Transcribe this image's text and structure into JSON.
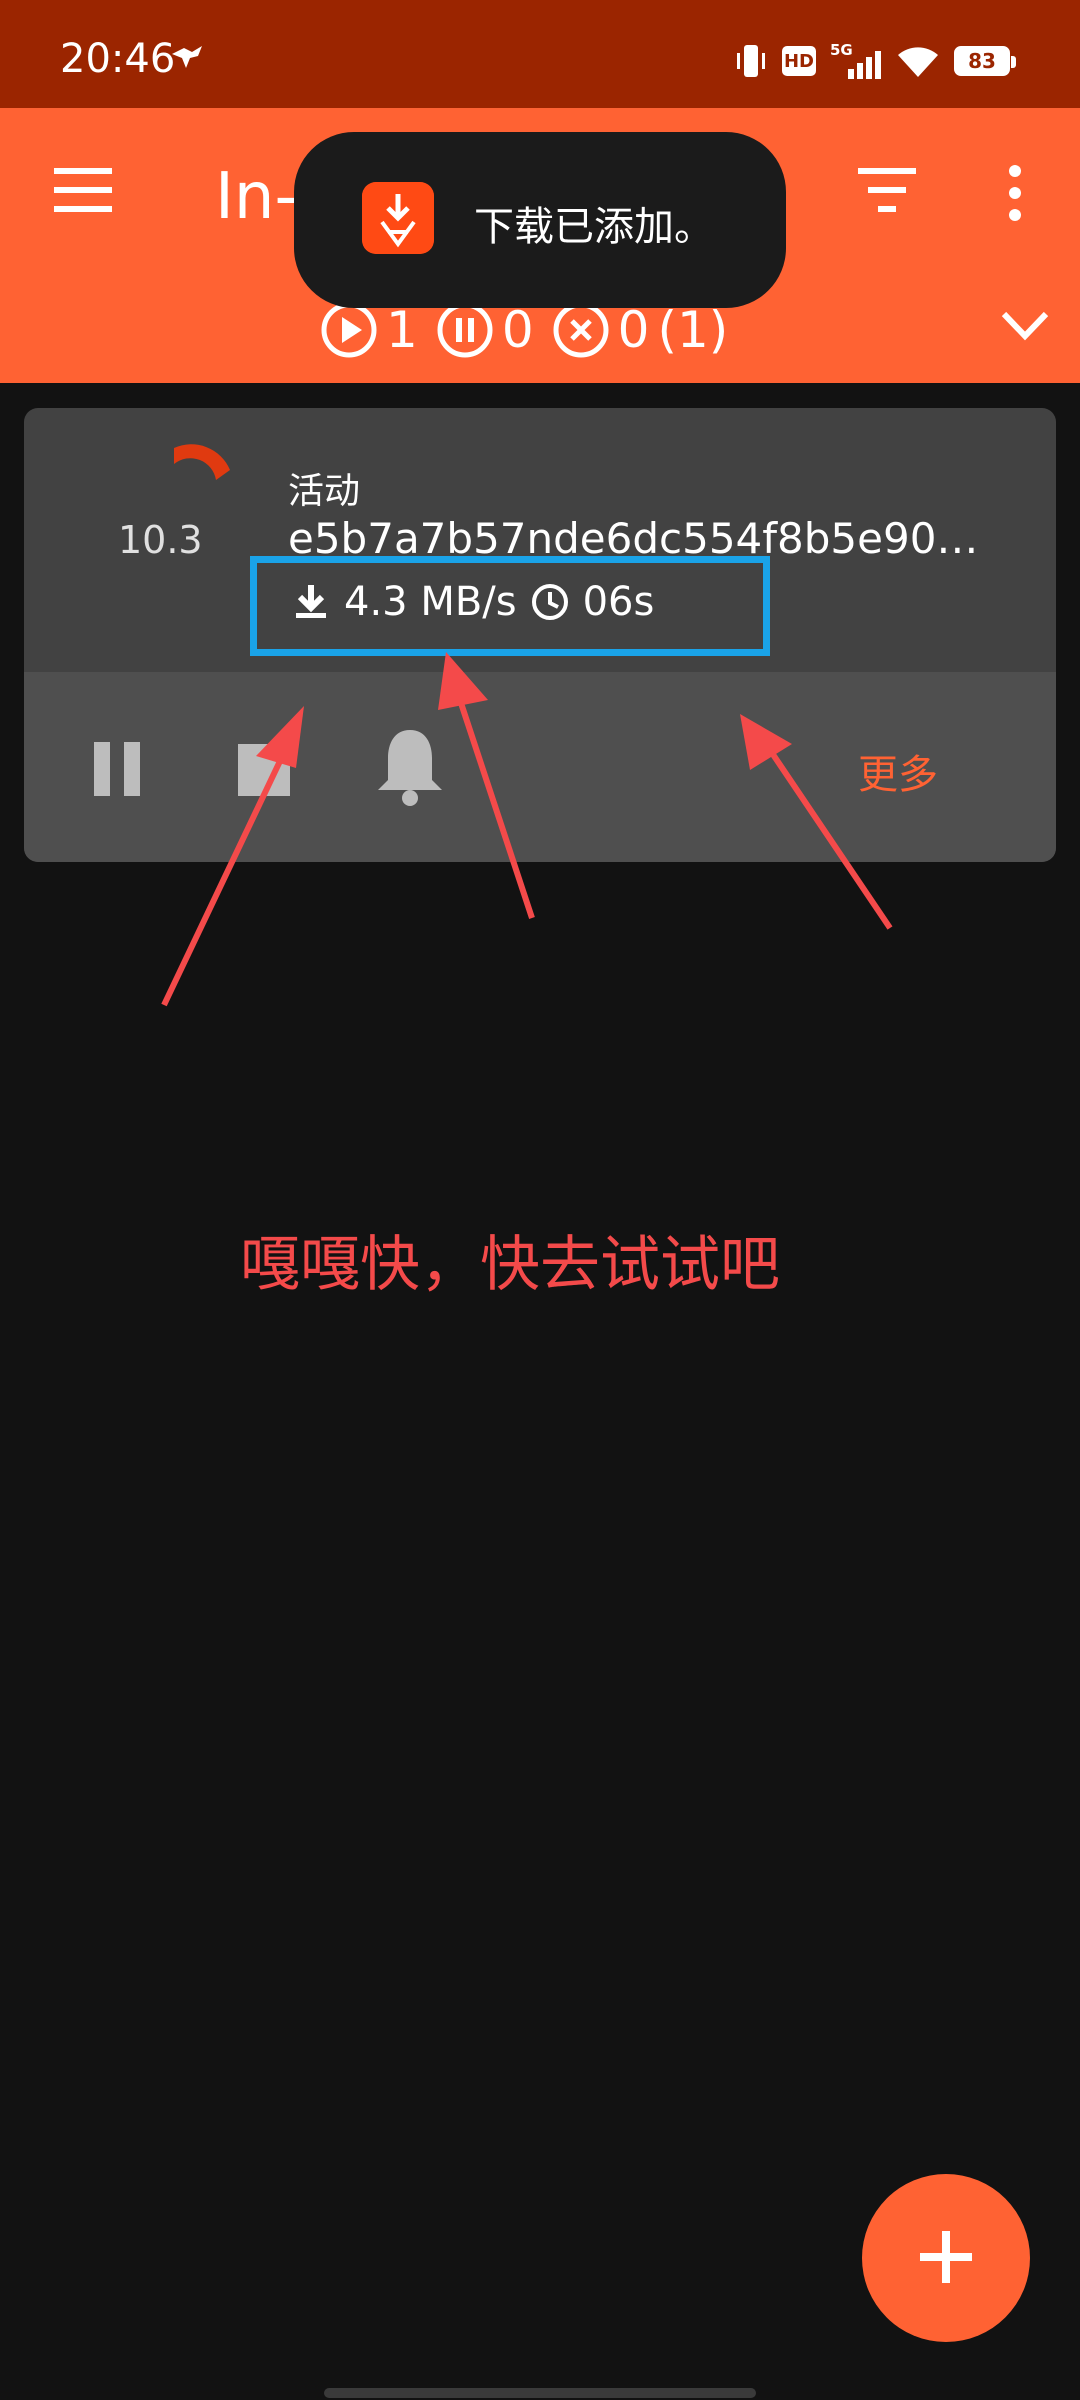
{
  "status_bar": {
    "time": "20:46",
    "network": "5G",
    "hd_label": "HD",
    "battery": "83"
  },
  "toolbar": {
    "title": "In-",
    "counters": {
      "active": "1",
      "paused": "0",
      "error": "0",
      "total": "(1)"
    }
  },
  "toast": {
    "message": "下载已添加。"
  },
  "torrent": {
    "status": "活动",
    "name": "e5b7a7b57nde6dc554f8b5e90…",
    "progress": "10.3",
    "speed": "4.3 MB/s",
    "eta": "06s",
    "more_label": "更多"
  },
  "annotation": {
    "text": "嘎嘎快，快去试试吧"
  },
  "colors": {
    "accent": "#ff6233",
    "status_bar": "#9b2500",
    "card": "#424242",
    "highlight": "#1aa3e8",
    "annotation": "#f44a4a"
  }
}
